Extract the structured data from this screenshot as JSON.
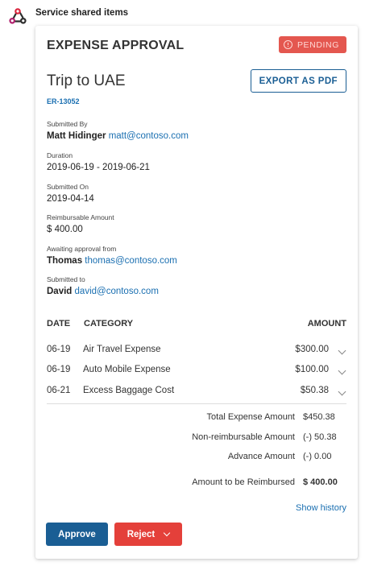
{
  "sender": {
    "name": "Service shared items",
    "icon": "webhook-icon"
  },
  "card": {
    "header_title": "EXPENSE APPROVAL",
    "status": "PENDING",
    "status_color": "#e4574f",
    "trip_title": "Trip to UAE",
    "export_label": "EXPORT AS PDF",
    "reference": "ER-13052",
    "submitted_by": {
      "label": "Submitted By",
      "name": "Matt Hidinger",
      "email": "matt@contoso.com"
    },
    "duration": {
      "label": "Duration",
      "value": "2019-06-19 - 2019-06-21"
    },
    "submitted_on": {
      "label": "Submitted On",
      "value": "2019-04-14"
    },
    "reimbursable": {
      "label": "Reimbursable Amount",
      "value": "$ 400.00"
    },
    "awaiting": {
      "label": "Awaiting approval from",
      "name": "Thomas",
      "email": "thomas@contoso.com"
    },
    "submitted_to": {
      "label": "Submitted to",
      "name": "David",
      "email": "david@contoso.com"
    },
    "table": {
      "headers": {
        "date": "DATE",
        "category": "CATEGORY",
        "amount": "AMOUNT"
      },
      "rows": [
        {
          "date": "06-19",
          "category": "Air Travel Expense",
          "amount": "$300.00"
        },
        {
          "date": "06-19",
          "category": "Auto Mobile Expense",
          "amount": "$100.00"
        },
        {
          "date": "06-21",
          "category": "Excess Baggage Cost",
          "amount": "$50.38"
        }
      ]
    },
    "summary": {
      "total_label": "Total Expense Amount",
      "total_value": "$450.38",
      "nonreimb_label": "Non-reimbursable Amount",
      "nonreimb_value": "(-) 50.38",
      "advance_label": "Advance Amount",
      "advance_value": "(-) 0.00",
      "reimbursed_label": "Amount to be Reimbursed",
      "reimbursed_value": "$ 400.00"
    },
    "show_history": "Show history",
    "approve_label": "Approve",
    "reject_label": "Reject",
    "accent_blue": "#1a5e94",
    "reject_red": "#e4403a"
  }
}
